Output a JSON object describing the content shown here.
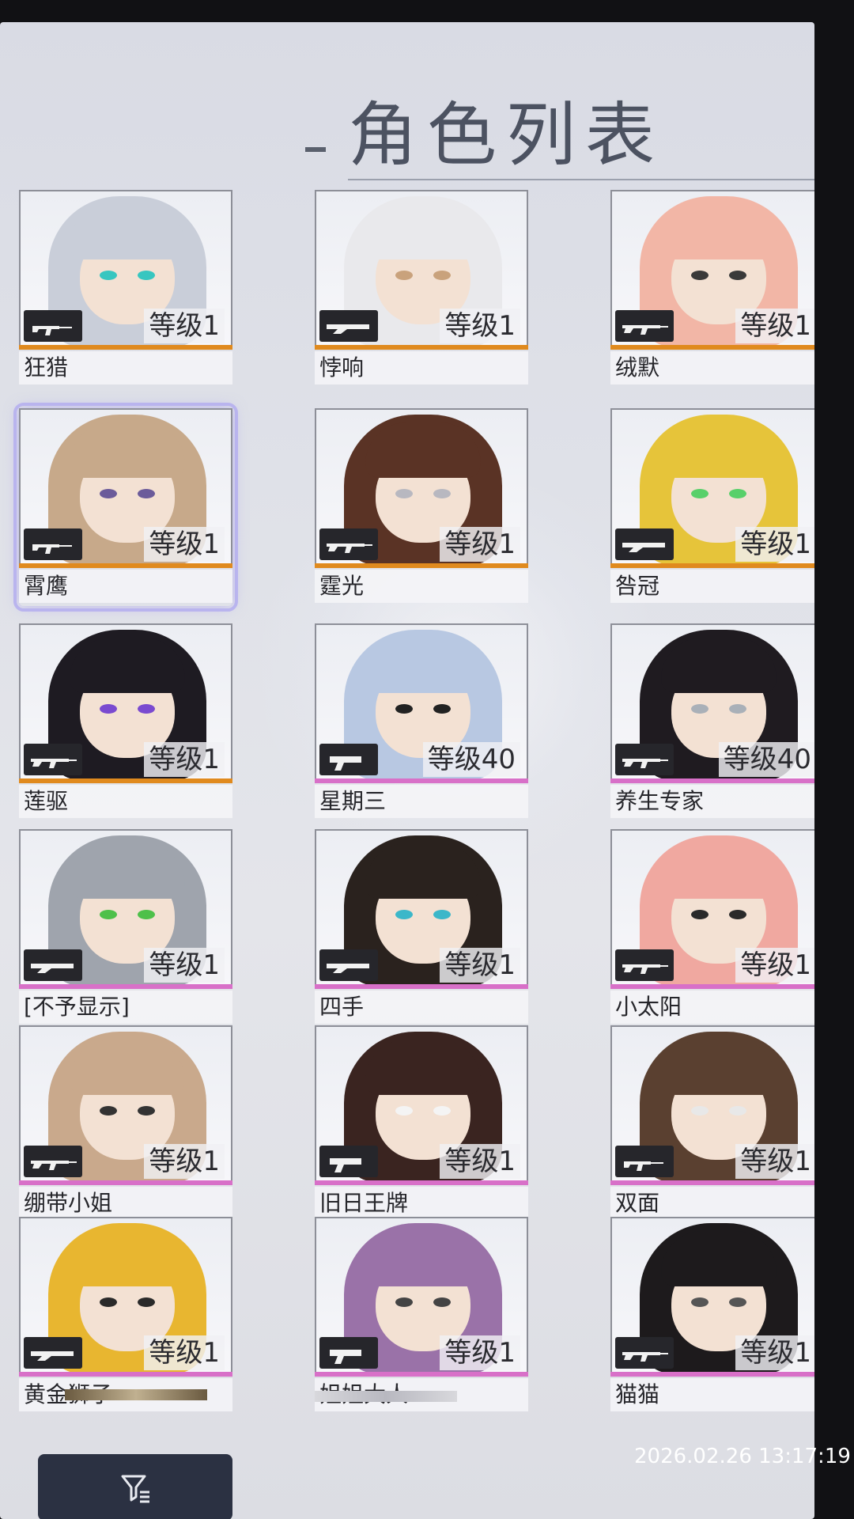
{
  "header": {
    "title": "角色列表"
  },
  "characters": [
    {
      "name": "狂猎",
      "level": "等级1",
      "weapon_icon": "smg-icon",
      "rarity_color": "#e08a1e",
      "hair": "#c9ced9",
      "accent": "#37c6c0"
    },
    {
      "name": "悖响",
      "level": "等级1",
      "weapon_icon": "shotgun-icon",
      "rarity_color": "#e08a1e",
      "hair": "#e9e9ec",
      "accent": "#c9a27c"
    },
    {
      "name": "绒默",
      "level": "等级1",
      "weapon_icon": "rifle-icon",
      "rarity_color": "#e08a1e",
      "hair": "#f2b6a6",
      "accent": "#3a3a3a"
    },
    {
      "name": "霄鹰",
      "level": "等级1",
      "weapon_icon": "smg-icon",
      "rarity_color": "#e08a1e",
      "hair": "#c7a98a",
      "accent": "#6b5b9a"
    },
    {
      "name": "霆光",
      "level": "等级1",
      "weapon_icon": "rifle-icon",
      "rarity_color": "#e08a1e",
      "hair": "#5a3325",
      "accent": "#b8b8c0"
    },
    {
      "name": "咎冠",
      "level": "等级1",
      "weapon_icon": "shotgun-icon",
      "rarity_color": "#e08a1e",
      "hair": "#e6c43a",
      "accent": "#58d06a"
    },
    {
      "name": "莲驱",
      "level": "等级1",
      "weapon_icon": "rifle-icon",
      "rarity_color": "#e08a1e",
      "hair": "#1e1b22",
      "accent": "#7a4ad0"
    },
    {
      "name": "星期三",
      "level": "等级40",
      "weapon_icon": "pistol-icon",
      "rarity_color": "#d870c8",
      "hair": "#b8c8e2",
      "accent": "#222"
    },
    {
      "name": "养生专家",
      "level": "等级40",
      "weapon_icon": "rifle-icon",
      "rarity_color": "#d870c8",
      "hair": "#1f1b20",
      "accent": "#a9b0b8"
    },
    {
      "name": "[不予显示]",
      "level": "等级1",
      "weapon_icon": "shotgun-icon",
      "rarity_color": "#d870c8",
      "hair": "#9fa4ad",
      "accent": "#4ec04a"
    },
    {
      "name": "四手",
      "level": "等级1",
      "weapon_icon": "shotgun-icon",
      "rarity_color": "#d870c8",
      "hair": "#2a221e",
      "accent": "#3bb7c9"
    },
    {
      "name": "小太阳",
      "level": "等级1",
      "weapon_icon": "rifle-icon",
      "rarity_color": "#d870c8",
      "hair": "#f0a8a0",
      "accent": "#2a2a2a"
    },
    {
      "name": "绷带小姐",
      "level": "等级1",
      "weapon_icon": "rifle-icon",
      "rarity_color": "#d870c8",
      "hair": "#c9a98c",
      "accent": "#333"
    },
    {
      "name": "旧日王牌",
      "level": "等级1",
      "weapon_icon": "pistol-icon",
      "rarity_color": "#d870c8",
      "hair": "#3a2420",
      "accent": "#f4f4f4"
    },
    {
      "name": "双面",
      "level": "等级1",
      "weapon_icon": "smg-icon",
      "rarity_color": "#d870c8",
      "hair": "#5a4030",
      "accent": "#e8e8e8"
    },
    {
      "name": "黄金狮子",
      "level": "等级1",
      "weapon_icon": "shotgun-icon",
      "rarity_color": "#d870c8",
      "hair": "#e8b630",
      "accent": "#2a2a2a"
    },
    {
      "name": "姐姐大人",
      "level": "等级1",
      "weapon_icon": "pistol-icon",
      "rarity_color": "#d870c8",
      "hair": "#9a72a8",
      "accent": "#444"
    },
    {
      "name": "猫猫",
      "level": "等级1",
      "weapon_icon": "rifle-icon",
      "rarity_color": "#d870c8",
      "hair": "#1d1a1c",
      "accent": "#555"
    }
  ],
  "footer": {
    "filter_icon": "filter-icon"
  },
  "overlay": {
    "timestamp": "2026.02.26 13:17:19"
  }
}
